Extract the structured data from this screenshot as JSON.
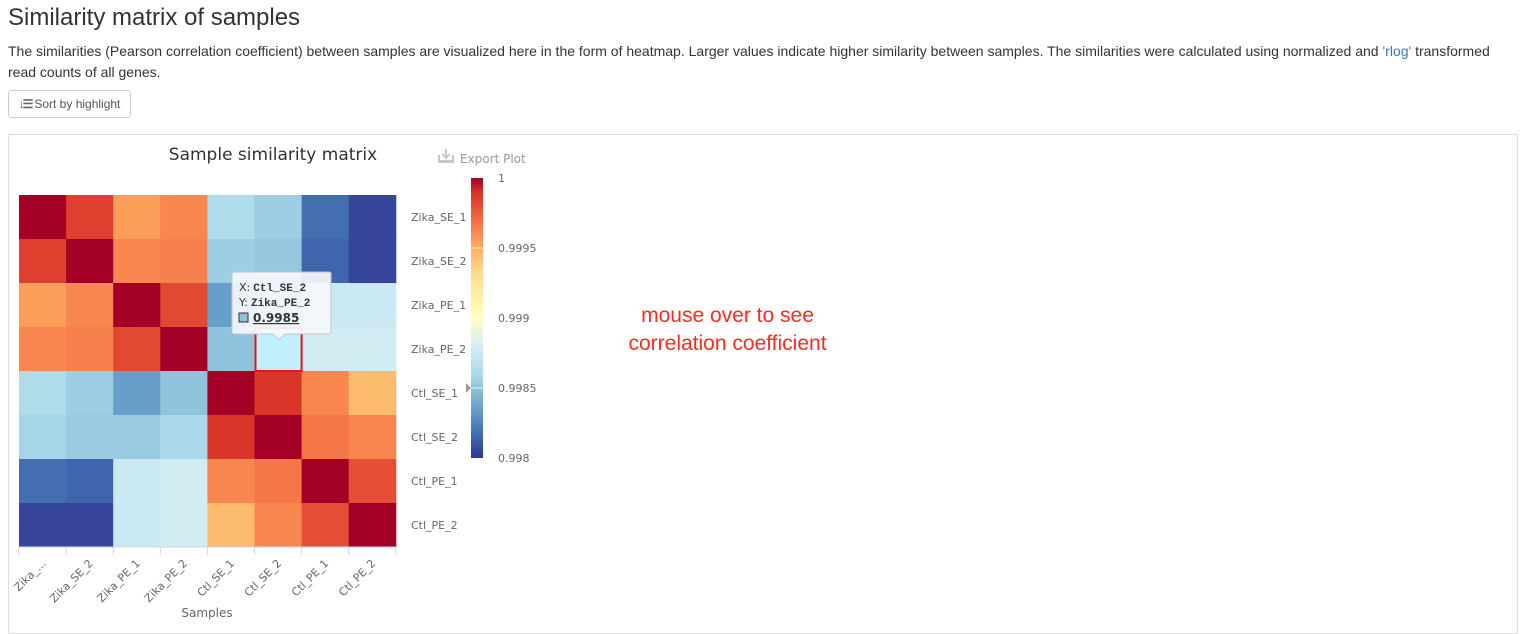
{
  "page": {
    "title": "Similarity matrix of samples",
    "description_before_link": "The similarities (Pearson correlation coefficient) between samples are visualized here in the form of heatmap. Larger values indicate higher similarity between samples. The similarities were calculated using normalized and ",
    "description_link": "'rlog'",
    "description_after_link": " transformed read counts of all genes.",
    "sort_button_label": "Sort by highlight",
    "sort_icon": "sort-amount-down-icon"
  },
  "plot": {
    "export_label": "Export Plot",
    "annotation": "mouse over to see correlation coefficient",
    "tooltip": {
      "x_label": "X:",
      "x_value": "Ctl_SE_2",
      "y_label": "Y:",
      "y_value": "Zika_PE_2",
      "value": "0.9985"
    },
    "highlight_color": "#e8131b"
  },
  "chart_data": {
    "type": "heatmap",
    "title": "Sample similarity matrix",
    "xlabel": "Samples",
    "ylabel": "",
    "x_categories": [
      "Zika_SE_1",
      "Zika_SE_2",
      "Zika_PE_1",
      "Zika_PE_2",
      "Ctl_SE_1",
      "Ctl_SE_2",
      "Ctl_PE_1",
      "Ctl_PE_2"
    ],
    "x_tick_labels": [
      "Zika_...",
      "Zika_SE_2",
      "Zika_PE_1",
      "Zika_PE_2",
      "Ctl_SE_1",
      "Ctl_SE_2",
      "Ctl_PE_1",
      "Ctl_PE_2"
    ],
    "y_categories": [
      "Zika_SE_1",
      "Zika_SE_2",
      "Zika_PE_1",
      "Zika_PE_2",
      "Ctl_SE_1",
      "Ctl_SE_2",
      "Ctl_PE_1",
      "Ctl_PE_2"
    ],
    "values": [
      [
        1.0,
        0.99985,
        0.99955,
        0.99962,
        0.99862,
        0.99855,
        0.99818,
        0.99805
      ],
      [
        0.99985,
        1.0,
        0.99962,
        0.99964,
        0.99855,
        0.99852,
        0.99815,
        0.99805
      ],
      [
        0.99955,
        0.99962,
        1.0,
        0.99982,
        0.99835,
        0.9985,
        0.99875,
        0.99875
      ],
      [
        0.99962,
        0.99964,
        0.99982,
        1.0,
        0.9985,
        0.9985,
        0.99878,
        0.99878
      ],
      [
        0.99862,
        0.99855,
        0.99835,
        0.9985,
        1.0,
        0.99988,
        0.99962,
        0.99945
      ],
      [
        0.99858,
        0.99853,
        0.99853,
        0.9986,
        0.99988,
        1.0,
        0.99967,
        0.99962
      ],
      [
        0.99818,
        0.99815,
        0.99875,
        0.99878,
        0.99962,
        0.99967,
        1.0,
        0.9998
      ],
      [
        0.99805,
        0.99805,
        0.99875,
        0.99878,
        0.99945,
        0.99962,
        0.9998,
        1.0
      ]
    ],
    "colorscale": {
      "min": 0.998,
      "max": 1,
      "ticks": [
        "1",
        "0.9995",
        "0.999",
        "0.9985",
        "0.998"
      ],
      "tick_values": [
        1,
        0.9995,
        0.999,
        0.9985,
        0.998
      ],
      "stops": [
        {
          "v": 0.998,
          "color": "#313695"
        },
        {
          "v": 0.9982,
          "color": "#4575b4"
        },
        {
          "v": 0.9984,
          "color": "#74add1"
        },
        {
          "v": 0.9986,
          "color": "#abd9e9"
        },
        {
          "v": 0.9988,
          "color": "#d6eef5"
        },
        {
          "v": 0.999,
          "color": "#ffffbf"
        },
        {
          "v": 0.9993,
          "color": "#fee090"
        },
        {
          "v": 0.9995,
          "color": "#fdae61"
        },
        {
          "v": 0.9997,
          "color": "#f46d43"
        },
        {
          "v": 0.9999,
          "color": "#d73027"
        },
        {
          "v": 1.0,
          "color": "#a50026"
        }
      ],
      "pointer_value": 0.9985
    },
    "highlighted_cell": {
      "x": "Ctl_SE_2",
      "y": "Zika_PE_2"
    },
    "legend": "right"
  }
}
